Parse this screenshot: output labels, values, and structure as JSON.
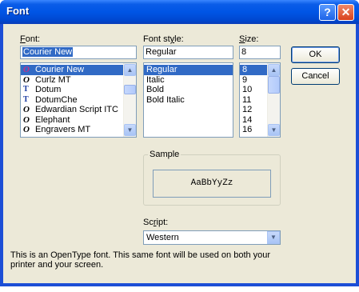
{
  "window": {
    "title": "Font",
    "help_glyph": "?",
    "close_glyph": "✕"
  },
  "font": {
    "label": "Font:",
    "value": "Courier New",
    "items": [
      {
        "icon": "O",
        "name": "Courier New"
      },
      {
        "icon": "O",
        "name": "Curlz MT"
      },
      {
        "icon": "TT",
        "name": "Dotum"
      },
      {
        "icon": "TT",
        "name": "DotumChe"
      },
      {
        "icon": "O",
        "name": "Edwardian Script ITC"
      },
      {
        "icon": "O",
        "name": "Elephant"
      },
      {
        "icon": "O",
        "name": "Engravers MT"
      }
    ]
  },
  "style": {
    "label": "Font style:",
    "value": "Regular",
    "items": [
      "Regular",
      "Italic",
      "Bold",
      "Bold Italic"
    ]
  },
  "size": {
    "label": "Size:",
    "value": "8",
    "items": [
      "8",
      "9",
      "10",
      "11",
      "12",
      "14",
      "16"
    ]
  },
  "buttons": {
    "ok": "OK",
    "cancel": "Cancel"
  },
  "sample": {
    "label": "Sample",
    "text": "AaBbYyZz"
  },
  "script": {
    "label": "Script:",
    "value": "Western"
  },
  "description": {
    "line1": "This is an OpenType font. This same font will be used on both your",
    "line2": "printer and your screen."
  },
  "scrollbar_glyphs": {
    "up": "▲",
    "down": "▼"
  },
  "colors": {
    "selection": "#316ac5",
    "dialog_bg": "#ece9d8",
    "titlebar": "#0055e5"
  }
}
